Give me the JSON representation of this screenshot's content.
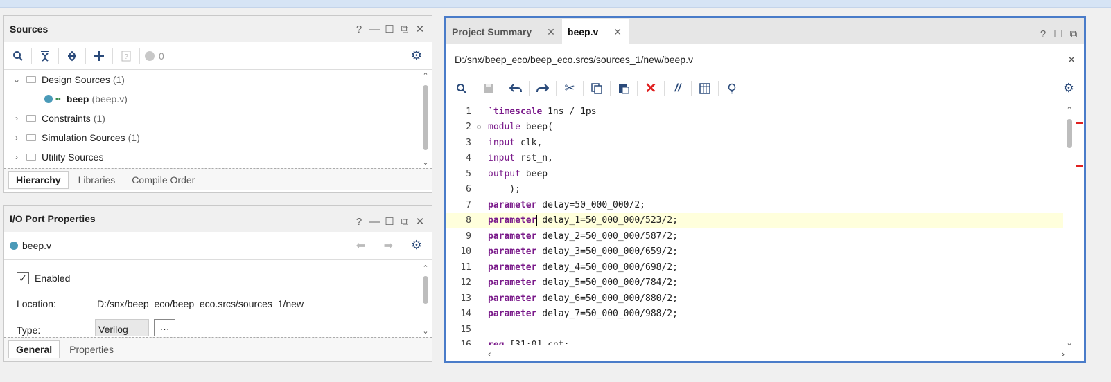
{
  "sources": {
    "title": "Sources",
    "win_controls": [
      "?",
      "—",
      "☐",
      "⧉",
      "✕"
    ],
    "toolbar_count": "0",
    "tree": [
      {
        "label": "Design Sources",
        "count": "(1)",
        "expanded": true
      },
      {
        "label": "beep",
        "file": "(beep.v)",
        "child": true
      },
      {
        "label": "Constraints",
        "count": "(1)"
      },
      {
        "label": "Simulation Sources",
        "count": "(1)"
      },
      {
        "label": "Utility Sources",
        "count": ""
      }
    ],
    "tabs": [
      "Hierarchy",
      "Libraries",
      "Compile Order"
    ]
  },
  "io": {
    "title": "I/O Port Properties",
    "file": "beep.v",
    "enabled_label": "Enabled",
    "location_label": "Location:",
    "location_value": "D:/snx/beep_eco/beep_eco.srcs/sources_1/new",
    "type_label": "Type:",
    "type_value": "Verilog",
    "more_btn": "···",
    "tabs": [
      "General",
      "Properties"
    ]
  },
  "editor": {
    "tabs": [
      {
        "label": "Project Summary"
      },
      {
        "label": "beep.v"
      }
    ],
    "path": "D:/snx/beep_eco/beep_eco.srcs/sources_1/new/beep.v",
    "lines": [
      {
        "n": "1",
        "kw": "`timescale",
        "rest": " 1ns / 1ps"
      },
      {
        "n": "2",
        "kw2": "module",
        "rest": " beep("
      },
      {
        "n": "3",
        "kw2": "input",
        "rest": " clk,"
      },
      {
        "n": "4",
        "kw2": "input",
        "rest": " rst_n,"
      },
      {
        "n": "5",
        "kw2": "output",
        "rest": " beep"
      },
      {
        "n": "6",
        "rest": "    );"
      },
      {
        "n": "7",
        "kw": "parameter",
        "rest": " delay=50_000_000/2;"
      },
      {
        "n": "8",
        "kw": "parameter",
        "rest": " delay_1=50_000_000/523/2;"
      },
      {
        "n": "9",
        "kw": "parameter",
        "rest": " delay_2=50_000_000/587/2;"
      },
      {
        "n": "10",
        "kw": "parameter",
        "rest": " delay_3=50_000_000/659/2;"
      },
      {
        "n": "11",
        "kw": "parameter",
        "rest": " delay_4=50_000_000/698/2;"
      },
      {
        "n": "12",
        "kw": "parameter",
        "rest": " delay_5=50_000_000/784/2;"
      },
      {
        "n": "13",
        "kw": "parameter",
        "rest": " delay_6=50_000_000/880/2;"
      },
      {
        "n": "14",
        "kw": "parameter",
        "rest": " delay_7=50_000_000/988/2;"
      },
      {
        "n": "15",
        "rest": ""
      },
      {
        "n": "16",
        "kw": "reg",
        "rest": " [31:0] cnt;"
      }
    ]
  },
  "colors": {
    "accent": "#4a7cc9",
    "keyword": "#7a1a8a",
    "highlight": "#ffffdc",
    "error": "#e02020"
  }
}
